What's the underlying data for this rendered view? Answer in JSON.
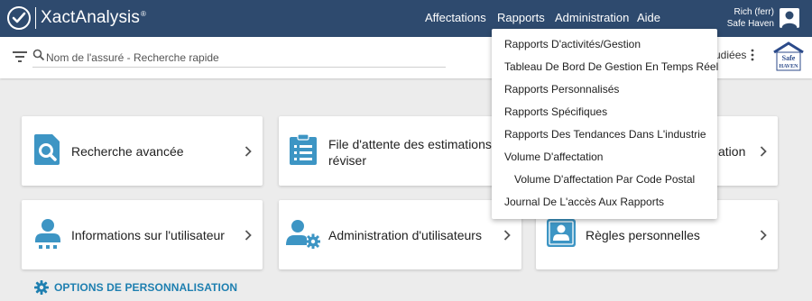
{
  "header": {
    "logo_text": "XactAnalysis",
    "logo_mark": "®",
    "nav": [
      "Affectations",
      "Rapports",
      "Administration",
      "Aide"
    ],
    "user_name": "Rich (ferr)",
    "user_company": "Safe Haven"
  },
  "searchbar": {
    "placeholder": "Nom de l'assuré - Recherche rapide",
    "studied_label": "udiées",
    "brand_logo_text_top": "Safe",
    "brand_logo_text_bottom": "HAVEN"
  },
  "cards": [
    {
      "title": "Recherche avancée",
      "icon": "search-document-icon"
    },
    {
      "title_line1": "File d'attente des estimations à",
      "title_line2": "réviser",
      "icon": "clipboard-icon"
    },
    {
      "title": "ation",
      "icon": ""
    },
    {
      "title": "Informations sur l'utilisateur",
      "icon": "user-info-icon"
    },
    {
      "title": "Administration d'utilisateurs",
      "icon": "user-admin-icon"
    },
    {
      "title": "Règles personnelles",
      "icon": "contact-card-icon"
    }
  ],
  "options_label": "OPTIONS DE PERSONNALISATION",
  "rapports_menu": [
    "Rapports D'activités/Gestion",
    "Tableau De Bord De Gestion En Temps Réel",
    "Rapports Personnalisés",
    "Rapports Spécifiques",
    "Rapports Des Tendances Dans L'industrie",
    "Volume D'affectation",
    "Volume D'affectation Par Code Postal",
    "Journal De L'accès Aux Rapports"
  ],
  "colors": {
    "topbar": "#2e4a6e",
    "accent": "#1e7fb0",
    "icon": "#3d95c4"
  }
}
